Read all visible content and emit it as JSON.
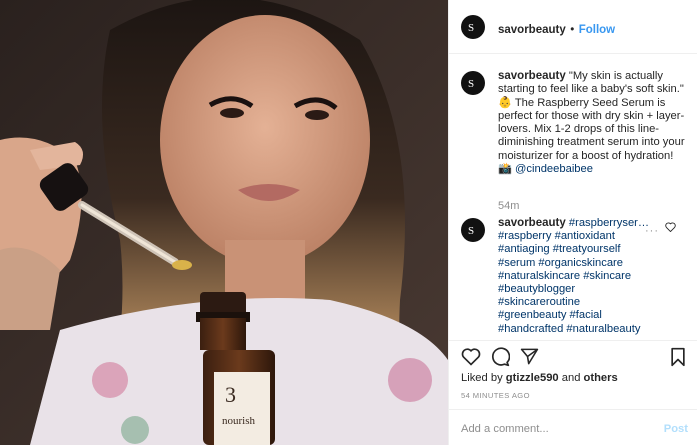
{
  "post": {
    "username": "savorbeauty",
    "follow_label": "Follow",
    "separator": "•",
    "caption_start": "\"My skin is actually starting to feel like a baby's soft skin.\"",
    "caption_emoji": "👶",
    "caption_rest": "The Raspberry Seed Serum is perfect for those with dry skin + layer-lovers. Mix 1-2 drops of this line-diminishing treatment serum into your moisturizer for a boost of hydration!",
    "camera_emoji": "📸",
    "caption_mention": "@cindeebaibee",
    "time": "54m",
    "comment_username": "savorbeauty",
    "hashtags": [
      "#raspberryser…",
      "#raspberry",
      "#antioxidant",
      "#antiaging",
      "#treatyourself",
      "#serum",
      "#organicskincare",
      "#naturalskincare",
      "#skincare",
      "#beautyblogger",
      "#skincareroutine",
      "#greenbeauty",
      "#facial",
      "#handcrafted",
      "#naturalbeauty"
    ],
    "comment_more": "···",
    "liked_by_prefix": "Liked by",
    "liked_by_user": "gtizzle590",
    "liked_by_and": "and",
    "liked_by_others": "others",
    "time_ago": "54 MINUTES AGO",
    "add_comment_placeholder": "Add a comment...",
    "post_label": "Post"
  },
  "photo": {
    "bottle_number": "3",
    "bottle_label": "nourish"
  },
  "icons": {
    "avatar": "savor-logo-icon",
    "like": "heart-icon",
    "comment": "comment-icon",
    "share": "share-icon",
    "save": "bookmark-icon",
    "comment_like": "heart-icon"
  },
  "colors": {
    "link": "#003569",
    "follow": "#3897f0",
    "muted": "#8e8e8e",
    "post_disabled": "#b2dffc"
  }
}
